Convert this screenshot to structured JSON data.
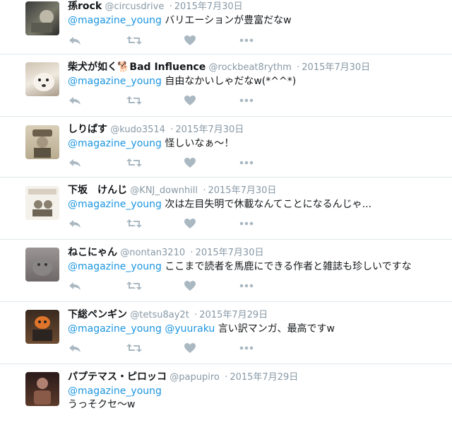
{
  "colors": {
    "mention": "#1b95e0",
    "meta": "#8899a6",
    "icon": "#aab8c2",
    "divider": "#e1e8ed"
  },
  "tweets": [
    {
      "name": "孫rock",
      "handle": "@circusdrive",
      "sep": "·",
      "time": "2015年7月30日",
      "mention": "@magazine_young",
      "text": "バリエーションが豊富だなw",
      "avatar_icon": "photo-avatar"
    },
    {
      "name": "柴犬が如く🐕Bad Influence",
      "handle": "@rockbeat8rythm",
      "sep": "·",
      "time": "2015年7月30日",
      "mention": "@magazine_young",
      "text": "自由なかいしゃだなw(*^^*)",
      "avatar_icon": "dog-avatar"
    },
    {
      "name": "しりぱす",
      "handle": "@kudo3514",
      "sep": "·",
      "time": "2015年7月30日",
      "mention": "@magazine_young",
      "text": "怪しいなぁ～！",
      "avatar_icon": "photo-avatar"
    },
    {
      "name": "下坂　けんじ",
      "handle": "@KNJ_downhill",
      "sep": "·",
      "time": "2015年7月30日",
      "mention": "@magazine_young",
      "text": "次は左目失明で休載なんてことになるんじゃ...",
      "avatar_icon": "drawing-avatar"
    },
    {
      "name": "ねこにゃん",
      "handle": "@nontan3210",
      "sep": "·",
      "time": "2015年7月30日",
      "mention": "@magazine_young",
      "text": "ここまで読者を馬鹿にできる作者と雑誌も珍しいですな",
      "avatar_icon": "photo-avatar"
    },
    {
      "name": "下総ペンギン",
      "handle": "@tetsu8ay2t",
      "sep": "·",
      "time": "2015年7月29日",
      "mention": "@magazine_young",
      "mention2": "@yuuraku",
      "text": "言い訳マンガ、最高ですw",
      "avatar_icon": "photo-avatar"
    },
    {
      "name": "パプテマス・ピロッコ",
      "handle": "@papupiro",
      "sep": "·",
      "time": "2015年7月29日",
      "mention": "@magazine_young",
      "text": "うっそクセ〜w",
      "avatar_icon": "photo-avatar"
    }
  ]
}
